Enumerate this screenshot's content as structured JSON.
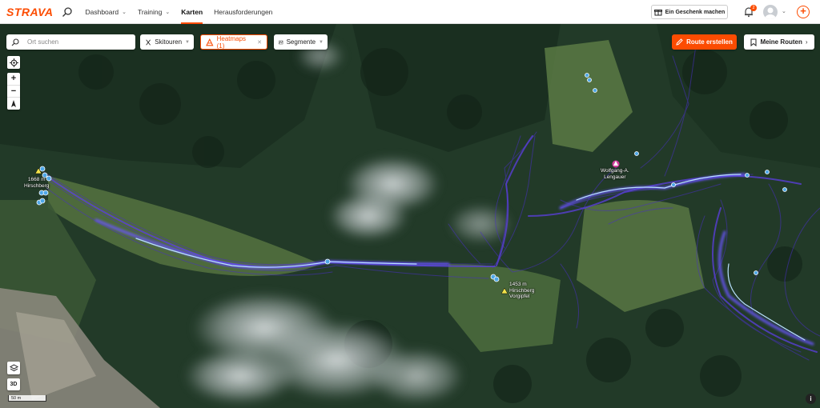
{
  "nav": {
    "logo": "STRAVA",
    "items": [
      {
        "label": "Dashboard",
        "chevron": true
      },
      {
        "label": "Training",
        "chevron": true
      },
      {
        "label": "Karten",
        "active": true
      },
      {
        "label": "Herausforderungen"
      }
    ],
    "gift_label": "Ein Geschenk machen",
    "notification_count": "2"
  },
  "map": {
    "search_placeholder": "Ort suchen",
    "filters": {
      "sport": "Skitouren",
      "heatmaps": "Heatmaps (1)",
      "segments": "Segmente"
    },
    "route_create": "Route erstellen",
    "my_routes": "Meine Routen",
    "zoom_in": "+",
    "zoom_out": "−",
    "btn_3d": "3D",
    "scale": "50 m",
    "places": [
      {
        "name": "1668 m\nHirschberg"
      },
      {
        "name": "1453 m\nHirschberg\nVorgipfel"
      },
      {
        "name": "Wolfgang-A.\nLengauer"
      }
    ]
  },
  "colors": {
    "brand": "#fc4c02",
    "heatmap": "#5b3bd6",
    "heatmap_hot": "#a9d8ff"
  }
}
